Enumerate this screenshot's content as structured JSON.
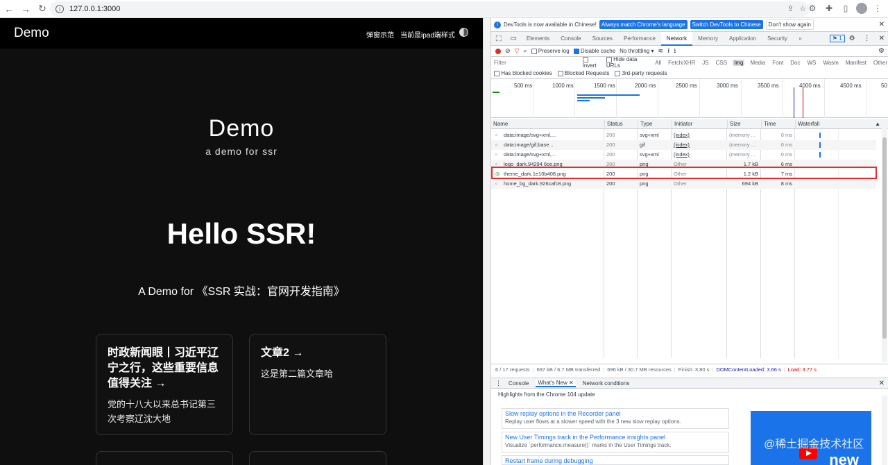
{
  "browser": {
    "url": "127.0.0.1:3000"
  },
  "site": {
    "brand": "Demo",
    "nav_popup": "弹窗示范",
    "nav_ipad": "当前是ipad端样式",
    "hero_title": "Demo",
    "hero_subtitle": "a demo for ssr",
    "hello": "Hello SSR!",
    "tagline": "A Demo for 《SSR 实战：官网开发指南》",
    "cards": [
      {
        "title": "时政新闻眼丨习近平辽宁之行，这些重要信息值得关注 →",
        "desc": "党的十八大以来总书记第三次考察辽沈大地"
      },
      {
        "title": "文章2 →",
        "desc": "这是第二篇文章哈"
      }
    ]
  },
  "devtools": {
    "infobar": {
      "message": "DevTools is now available in Chinese!",
      "match_btn": "Always match Chrome's language",
      "switch_btn": "Switch DevTools to Chinese",
      "dismiss_btn": "Don't show again"
    },
    "tabs": [
      "Elements",
      "Console",
      "Sources",
      "Performance",
      "Network",
      "Memory",
      "Application",
      "Security"
    ],
    "active_tab": "Network",
    "more_tabs": "»",
    "issues_count": "1",
    "toolbar": {
      "preserve_log": "Preserve log",
      "disable_cache": "Disable cache",
      "throttling": "No throttling"
    },
    "filter": {
      "placeholder": "Filter",
      "invert": "Invert",
      "hide_data_urls": "Hide data URLs",
      "types": [
        "All",
        "Fetch/XHR",
        "JS",
        "CSS",
        "Img",
        "Media",
        "Font",
        "Doc",
        "WS",
        "Wasm",
        "Manifest",
        "Other"
      ],
      "active_type": "Img",
      "blocked_cookies": "Has blocked cookies",
      "blocked_requests": "Blocked Requests",
      "third_party": "3rd-party requests"
    },
    "timeline_ticks": [
      "500 ms",
      "1000 ms",
      "1500 ms",
      "2000 ms",
      "2500 ms",
      "3000 ms",
      "3500 ms",
      "4000 ms",
      "4500 ms",
      "50"
    ],
    "columns": [
      "Name",
      "Status",
      "Type",
      "Initiator",
      "Size",
      "Time",
      "Waterfall"
    ],
    "rows": [
      {
        "name": "data:image/svg+xml,...",
        "status": "200",
        "type": "svg+xml",
        "initiator": "(index)",
        "size": "(memory ...",
        "time": "0 ms"
      },
      {
        "name": "data:image/gif;base...",
        "status": "200",
        "type": "gif",
        "initiator": "(index)",
        "size": "(memory ...",
        "time": "0 ms"
      },
      {
        "name": "data:image/svg+xml,...",
        "status": "200",
        "type": "svg+xml",
        "initiator": "(index)",
        "size": "(memory ...",
        "time": "0 ms"
      },
      {
        "name": "logo_dark.94294 6ce.png",
        "status": "200",
        "type": "png",
        "initiator": "Other",
        "size": "1.7 kB",
        "time": "6 ms"
      },
      {
        "name": "theme_dark.1e10b408.png",
        "status": "200",
        "type": "png",
        "initiator": "Other",
        "size": "1.2 kB",
        "time": "7 ms"
      },
      {
        "name": "home_bg_dark.926cafc8.png",
        "status": "200",
        "type": "png",
        "initiator": "Other",
        "size": "694 kB",
        "time": "8 ms"
      }
    ],
    "status": {
      "requests": "6 / 17 requests",
      "transferred": "697 kB / 6.7 MB transferred",
      "resources": "696 kB / 30.7 MB resources",
      "finish": "Finish: 3.80 s",
      "dcl": "DOMContentLoaded: 3.66 s",
      "load": "Load: 3.77 s"
    },
    "drawer": {
      "tabs": [
        "Console",
        "What's New",
        "Network conditions"
      ],
      "title": "Highlights from the Chrome 104 update",
      "items": [
        {
          "link": "Slow replay options in the Recorder panel",
          "text": "Replay user flows at a slower speed with the 3 new slow replay options."
        },
        {
          "link": "New User Timings track in the Performance insights panel",
          "text": "Visualize `performance.measure()` marks in the User Timings track."
        },
        {
          "link": "Restart frame during debugging",
          "text": ""
        }
      ],
      "promo_text": "new",
      "watermark": "@稀土掘金技术社区"
    }
  },
  "colors": {
    "accent": "#1a73e8",
    "highlight": "#e62d2d",
    "dcl": "#1a1aa6",
    "load": "#c80000"
  }
}
